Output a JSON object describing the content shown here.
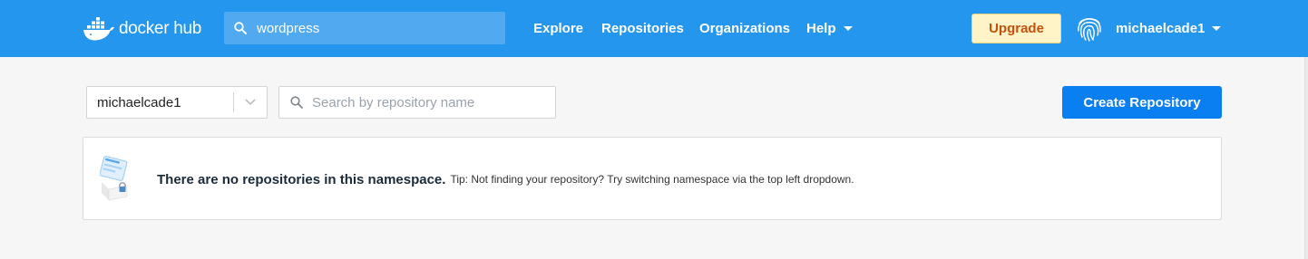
{
  "header": {
    "logo_text": "docker hub",
    "search_value": "wordpress",
    "nav": [
      {
        "label": "Explore"
      },
      {
        "label": "Repositories"
      },
      {
        "label": "Organizations"
      },
      {
        "label": "Help"
      }
    ],
    "upgrade_label": "Upgrade",
    "username": "michaelcade1"
  },
  "toolbar": {
    "namespace_value": "michaelcade1",
    "search_placeholder": "Search by repository name",
    "create_label": "Create Repository"
  },
  "empty_state": {
    "message": "There are no repositories in this namespace.",
    "tip": "Tip: Not finding your repository? Try switching namespace via the top left dropdown."
  },
  "colors": {
    "header_bg": "#2496ed",
    "primary_button": "#0a7ff2",
    "upgrade_bg": "#fff4c7",
    "upgrade_text": "#c2520e"
  },
  "icons": [
    "docker-whale-icon",
    "search-icon",
    "chevron-down-icon",
    "fingerprint-icon",
    "caret-down-icon",
    "repository-illustration-icon"
  ]
}
